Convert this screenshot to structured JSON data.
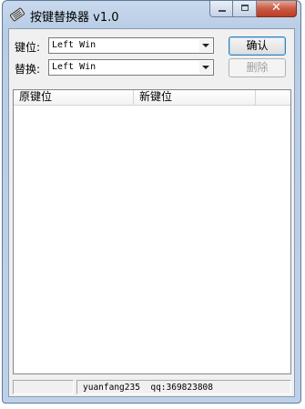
{
  "window": {
    "title": "按键替换器 v1.0",
    "icons": {
      "app": "keyboard-app-icon",
      "minimize": "minimize-icon",
      "maximize": "maximize-icon",
      "close": "close-icon"
    },
    "close_glyph": "✕",
    "colors": {
      "titlebar": "#bfd1e8",
      "close_button": "#c85b44",
      "client_background": "#f0f0f0"
    }
  },
  "form": {
    "key_label": "键位:",
    "key_value": "Left Win",
    "replace_label": "替换:",
    "replace_value": "Left Win",
    "confirm_label": "确认",
    "delete_label": "删除"
  },
  "table": {
    "columns": [
      "原键位",
      "新键位"
    ],
    "rows": []
  },
  "statusbar": {
    "left": "",
    "right": "yuanfang235  qq:369823808"
  }
}
